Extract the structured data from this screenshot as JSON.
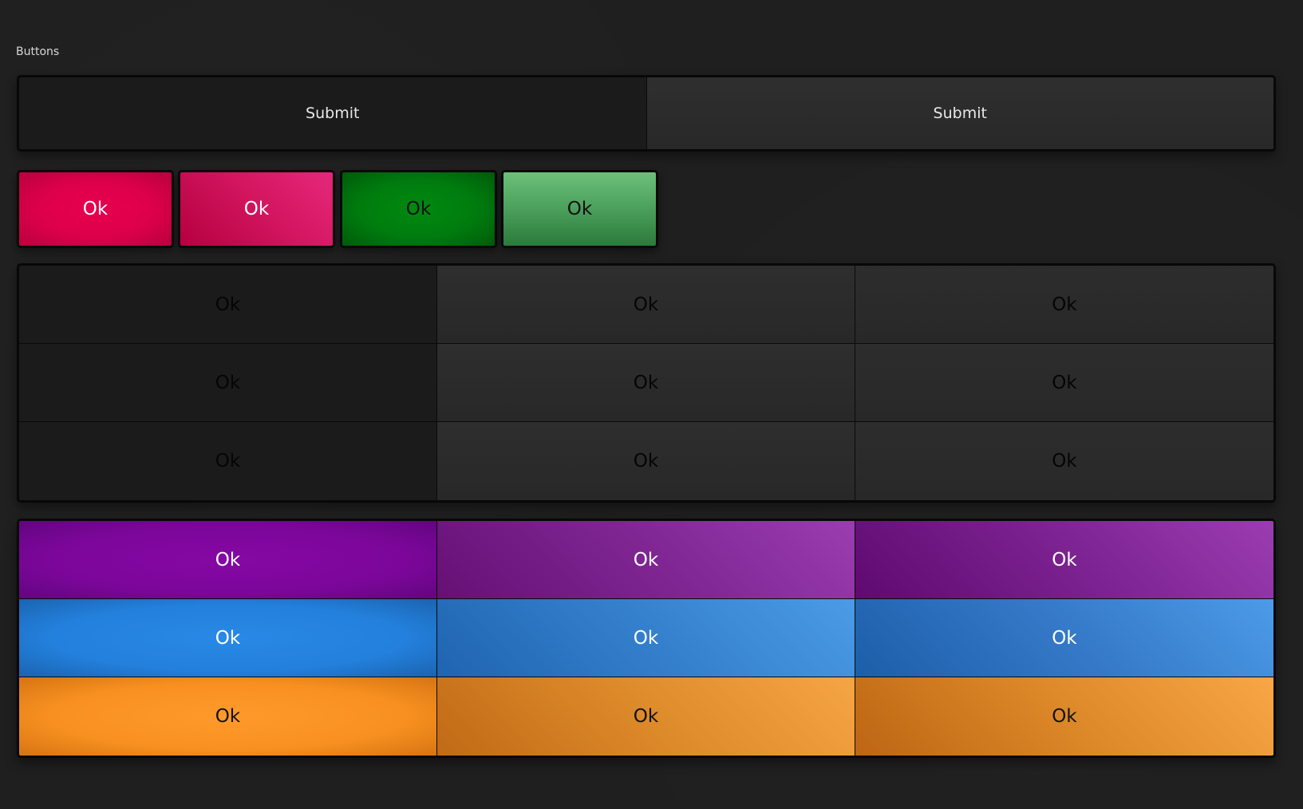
{
  "section": {
    "title": "Buttons"
  },
  "submit_group": {
    "buttons": [
      "Submit",
      "Submit"
    ]
  },
  "ok_row": {
    "buttons": [
      "Ok",
      "Ok",
      "Ok",
      "Ok"
    ],
    "colors": [
      "#e0004c",
      "#c8084f",
      "#007f0e",
      "#55a865"
    ]
  },
  "dark_grid": {
    "rows": [
      [
        "Ok",
        "Ok",
        "Ok"
      ],
      [
        "Ok",
        "Ok",
        "Ok"
      ],
      [
        "Ok",
        "Ok",
        "Ok"
      ]
    ]
  },
  "color_grid": {
    "rows": [
      [
        "Ok",
        "Ok",
        "Ok"
      ],
      [
        "Ok",
        "Ok",
        "Ok"
      ],
      [
        "Ok",
        "Ok",
        "Ok"
      ]
    ],
    "row_colors": [
      "#7e08a0",
      "#2382dd",
      "#f79020"
    ]
  }
}
